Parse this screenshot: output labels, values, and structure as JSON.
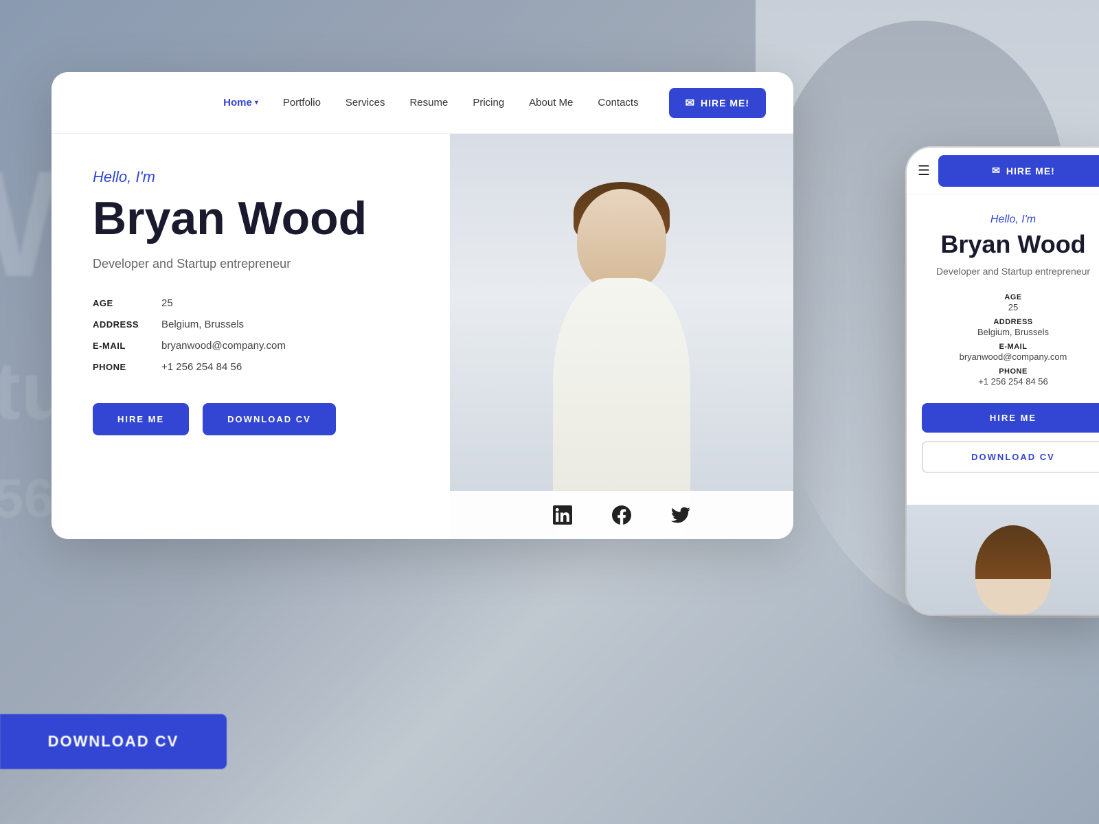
{
  "background": {
    "text1": "W",
    "text2": "tup",
    "text3": "56"
  },
  "nav": {
    "links": [
      {
        "label": "Home",
        "active": true,
        "has_dropdown": true
      },
      {
        "label": "Portfolio",
        "active": false
      },
      {
        "label": "Services",
        "active": false
      },
      {
        "label": "Resume",
        "active": false
      },
      {
        "label": "Pricing",
        "active": false
      },
      {
        "label": "About Me",
        "active": false
      },
      {
        "label": "Contacts",
        "active": false
      }
    ],
    "hire_button": "HIRE ME!"
  },
  "profile": {
    "greeting": "Hello, I'm",
    "name": "Bryan Wood",
    "subtitle": "Developer and Startup entrepreneur",
    "age_label": "AGE",
    "age_value": "25",
    "address_label": "ADDRESS",
    "address_value": "Belgium, Brussels",
    "email_label": "E-MAIL",
    "email_value": "bryanwood@company.com",
    "phone_label": "PHONE",
    "phone_value": "+1 256 254 84 56",
    "hire_me_button": "HIRE ME",
    "download_cv_button": "DOWNLOAD CV"
  },
  "social": {
    "linkedin_label": "linkedin-icon",
    "facebook_label": "facebook-icon",
    "twitter_label": "twitter-icon"
  },
  "mobile": {
    "greeting": "Hello, I'm",
    "name": "Bryan Wood",
    "subtitle": "Developer and Startup entrepreneur",
    "age_label": "AGE",
    "age_value": "25",
    "address_label": "ADDRESS",
    "address_value": "Belgium, Brussels",
    "email_label": "E-MAIL",
    "email_value": "bryanwood@company.com",
    "phone_label": "PHONE",
    "phone_value": "+1 256 254 84 56",
    "hire_me_button": "HIRE ME",
    "download_cv_button": "DOWNLOAD CV",
    "hire_btn_nav": "HIRE ME!"
  },
  "bg_download": "DOWNLOAD CV",
  "colors": {
    "accent": "#3346d3",
    "text_dark": "#1a1a2e",
    "text_muted": "#666"
  }
}
